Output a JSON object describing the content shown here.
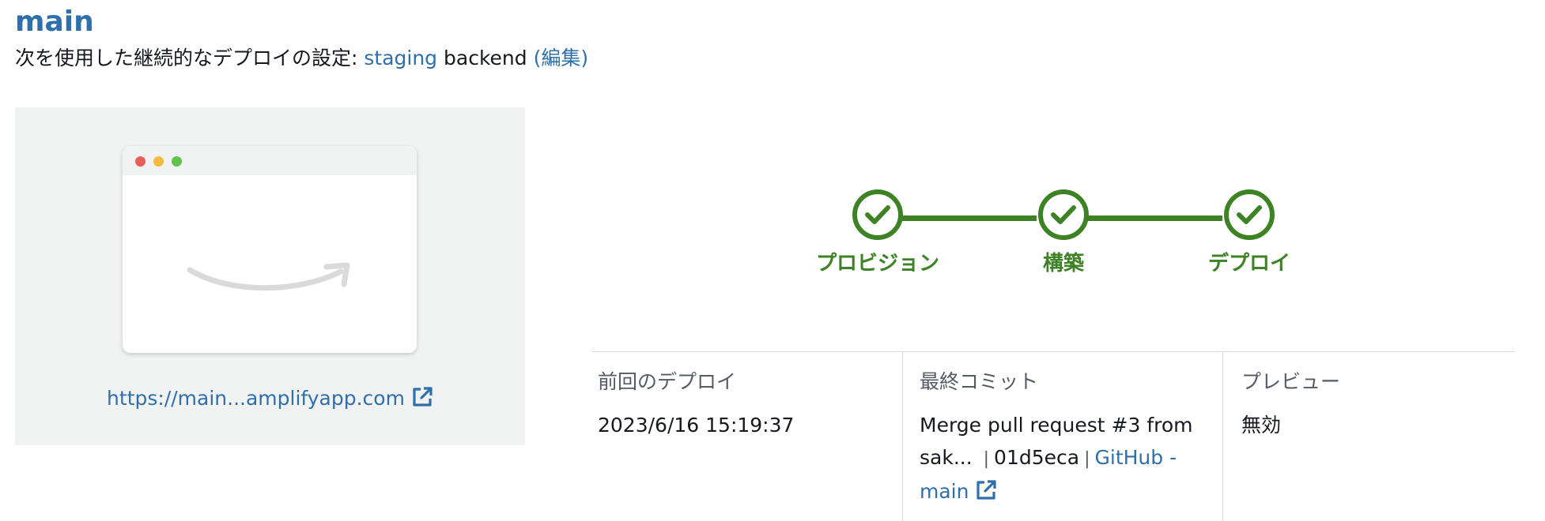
{
  "branch": {
    "name": "main"
  },
  "continuous_deploy": {
    "prefix": "次を使用した継続的なデプロイの設定: ",
    "env_link": "staging",
    "env_suffix": " backend ",
    "edit_link": "(編集)"
  },
  "preview": {
    "url": "https://main...amplifyapp.com",
    "external_icon": "external-link-icon"
  },
  "steps": [
    {
      "label": "プロビジョン",
      "status": "complete",
      "icon": "check-circle-icon"
    },
    {
      "label": "構築",
      "status": "complete",
      "icon": "check-circle-icon"
    },
    {
      "label": "デプロイ",
      "status": "complete",
      "icon": "check-circle-icon"
    }
  ],
  "info": {
    "last_deploy": {
      "label": "前回のデプロイ",
      "value": "2023/6/16 15:19:37"
    },
    "last_commit": {
      "label": "最終コミット",
      "message": "Merge pull request #3 from sak...",
      "separator": "|",
      "hash": "01d5eca",
      "repo_link_line1": "GitHub -",
      "repo_link_line2": "main"
    },
    "preview": {
      "label": "プレビュー",
      "value": "無効"
    }
  },
  "colors": {
    "link": "#2f6fab",
    "success": "#3d8224",
    "muted_text": "#545b64",
    "panel_bg": "#f1f3f3",
    "divider": "#d5dbdb"
  }
}
